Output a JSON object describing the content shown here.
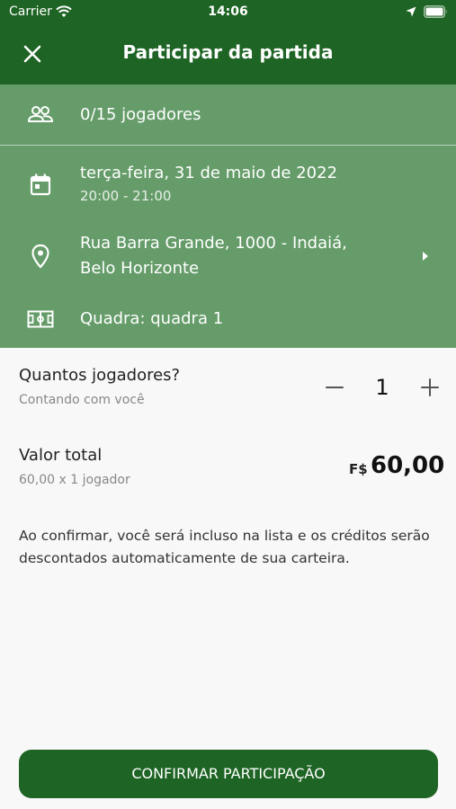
{
  "status_bar": {
    "carrier": "Carrier",
    "time": "14:06"
  },
  "header": {
    "title": "Participar da partida"
  },
  "match_info": {
    "players": "0/15 jogadores",
    "date": "terça-feira, 31 de maio de 2022",
    "time_range": "20:00 - 21:00",
    "address_line1": "Rua Barra Grande, 1000 - Indaiá,",
    "address_line2": "Belo Horizonte",
    "court": "Quadra: quadra 1"
  },
  "players_selector": {
    "label": "Quantos jogadores?",
    "sublabel": "Contando com você",
    "quantity": "1"
  },
  "total": {
    "label": "Valor total",
    "breakdown": "60,00 x 1 jogador",
    "currency": "F$",
    "value": "60,00"
  },
  "notice": "Ao confirmar, você será incluso na lista e os créditos serão descontados automaticamente de sua carteira.",
  "confirm_button": "CONFIRMAR PARTICIPAÇÃO",
  "colors": {
    "primary": "#1e6424",
    "panel": "#659c69",
    "background": "#f8f8f8"
  }
}
